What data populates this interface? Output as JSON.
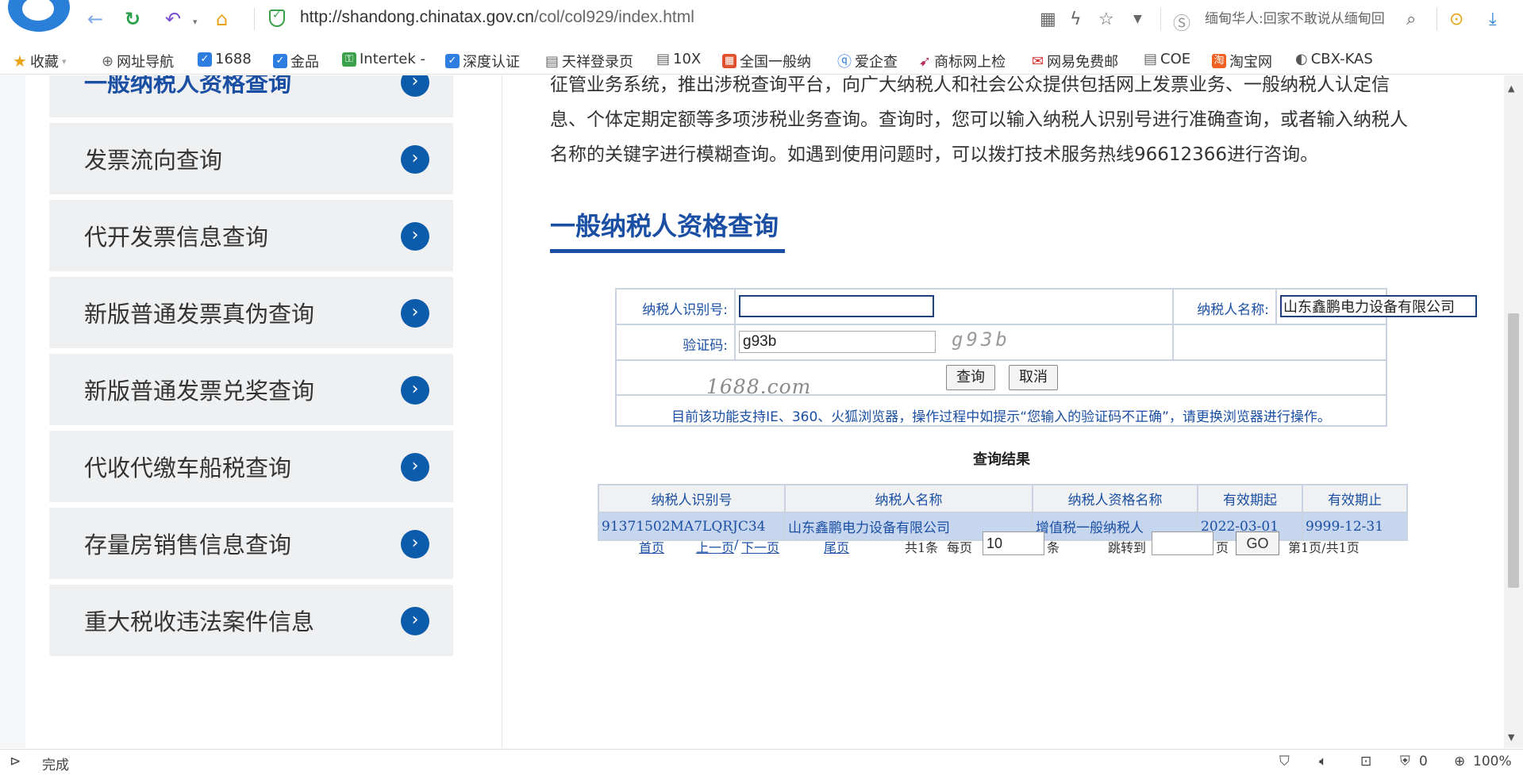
{
  "browser": {
    "url_host": "http://shandong.chinatax.gov.cn",
    "url_path": "/col/col929/index.html",
    "search_text": "缅甸华人:回家不敢说从缅甸回"
  },
  "bookmarks": [
    {
      "label": "收藏",
      "icon": "star-icon"
    },
    {
      "label": "网址导航",
      "icon": "globe-icon"
    },
    {
      "label": "1688",
      "icon": "shield-icon"
    },
    {
      "label": "金品",
      "icon": "shield-icon"
    },
    {
      "label": "Intertek -",
      "icon": "key-icon"
    },
    {
      "label": "深度认证",
      "icon": "shield-icon"
    },
    {
      "label": "天祥登录页",
      "icon": "document-icon"
    },
    {
      "label": "10X",
      "icon": "document-icon"
    },
    {
      "label": "全国一般纳",
      "icon": "grid-icon"
    },
    {
      "label": "爱企查",
      "icon": "q-icon"
    },
    {
      "label": "商标网上检",
      "icon": "arrow-icon"
    },
    {
      "label": "网易免费邮",
      "icon": "mail-icon"
    },
    {
      "label": "COE",
      "icon": "document-icon"
    },
    {
      "label": "淘宝网",
      "icon": "taobao-icon"
    },
    {
      "label": "CBX-KAS",
      "icon": "chrome-icon"
    }
  ],
  "sidebar": {
    "items": [
      {
        "label": "一般纳税人资格查询"
      },
      {
        "label": "发票流向查询"
      },
      {
        "label": "代开发票信息查询"
      },
      {
        "label": "新版普通发票真伪查询"
      },
      {
        "label": "新版普通发票兑奖查询"
      },
      {
        "label": "代收代缴车船税查询"
      },
      {
        "label": "存量房销售信息查询"
      },
      {
        "label": "重大税收违法案件信息"
      }
    ]
  },
  "main": {
    "intro_line1": "征管业务系统，推出涉税查询平台，向广大纳税人和社会公众提供包括网上发票业务、一般纳税人认定信",
    "intro_line2": "息、个体定期定额等多项涉税业务查询。查询时，您可以输入纳税人识别号进行准确查询，或者输入纳税人",
    "intro_line3": "名称的关键字进行模糊查询。如遇到使用问题时，可以拨打技术服务热线96612366进行咨询。",
    "section_title": "一般纳税人资格查询"
  },
  "form": {
    "taxpayer_id_label": "纳税人识别号:",
    "taxpayer_id_value": "",
    "taxpayer_name_label": "纳税人名称:",
    "taxpayer_name_value": "山东鑫鹏电力设备有限公司",
    "captcha_label": "验证码:",
    "captcha_input_value": "g93b",
    "captcha_image_text": "g93b",
    "query_button": "查询",
    "cancel_button": "取消",
    "notice": "目前该功能支持IE、360、火狐浏览器，操作过程中如提示“您输入的验证码不正确”，请更换浏览器进行操作。",
    "watermark": "1688.com"
  },
  "results": {
    "title": "查询结果",
    "columns": [
      "纳税人识别号",
      "纳税人名称",
      "纳税人资格名称",
      "有效期起",
      "有效期止"
    ],
    "rows": [
      [
        "91371502MA7LQRJC34",
        "山东鑫鹏电力设备有限公司",
        "增值税一般纳税人",
        "2022-03-01",
        "9999-12-31"
      ]
    ]
  },
  "pagination": {
    "first": "首页",
    "prev": "上一页",
    "slash": "/",
    "next": "下一页",
    "last": "尾页",
    "total_text": "共1条",
    "per_page_label": "每页",
    "per_page_value": "10",
    "per_page_unit": "条",
    "jump_label": "跳转到",
    "jump_value": "",
    "page_unit": "页",
    "go_button": "GO",
    "page_info": "第1页/共1页"
  },
  "statusbar": {
    "status": "完成",
    "blocked_count": "0",
    "zoom": "100%"
  }
}
